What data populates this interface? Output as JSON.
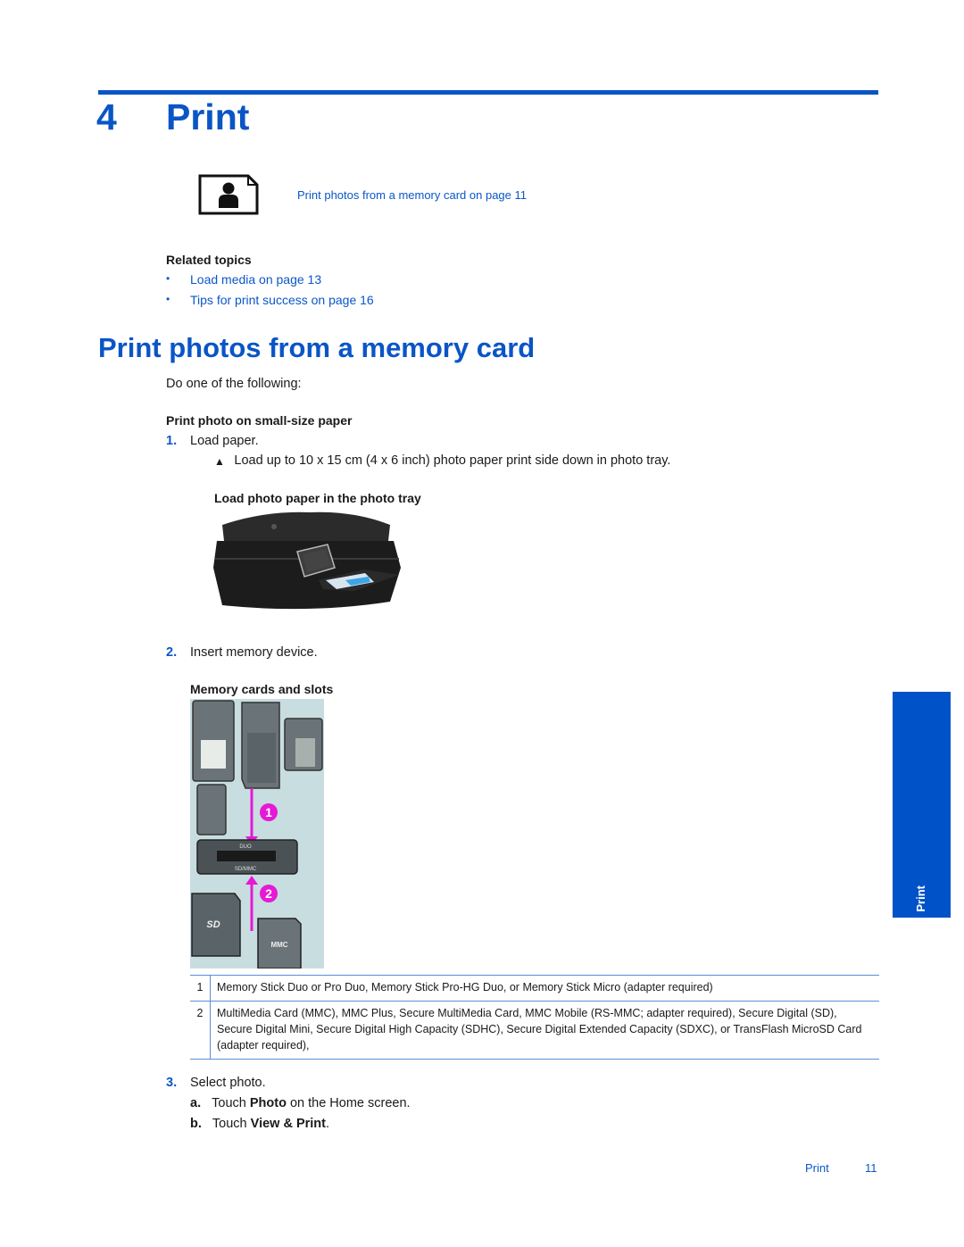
{
  "chapter": {
    "number": "4",
    "title": "Print"
  },
  "toc_link": "Print photos from a memory card on page 11",
  "related": {
    "heading": "Related topics",
    "links": [
      "Load media on page 13",
      "Tips for print success on page 16"
    ]
  },
  "section": {
    "title": "Print photos from a memory card",
    "intro": "Do one of the following:",
    "subheading": "Print photo on small-size paper",
    "steps": [
      {
        "num": "1.",
        "text": "Load paper."
      },
      {
        "num": "2.",
        "text": "Insert memory device."
      },
      {
        "num": "3.",
        "text": "Select photo."
      }
    ],
    "step1_note_icon": "triangle-up-icon",
    "step1_note": "Load up to 10 x 15 cm (4 x 6 inch) photo paper print side down in photo tray.",
    "figure1_caption": "Load photo paper in the photo tray",
    "figure2_caption": "Memory cards and slots",
    "figure2_labels": {
      "slot_top": "DUO",
      "slot_bottom": "SD/MMC",
      "sd_card": "SD",
      "mmc_card": "MMC",
      "callout1": "1",
      "callout2": "2"
    },
    "table": [
      {
        "num": "1",
        "text": "Memory Stick Duo or Pro Duo, Memory Stick Pro-HG Duo, or Memory Stick Micro (adapter required)"
      },
      {
        "num": "2",
        "text": "MultiMedia Card (MMC), MMC Plus, Secure MultiMedia Card, MMC Mobile (RS-MMC; adapter required), Secure Digital (SD), Secure Digital Mini, Secure Digital High Capacity (SDHC), Secure Digital Extended Capacity (SDXC), or TransFlash MicroSD Card (adapter required),"
      }
    ],
    "substeps": [
      {
        "letter": "a.",
        "pre": "Touch ",
        "bold": "Photo",
        "post": " on the Home screen."
      },
      {
        "letter": "b.",
        "pre": "Touch ",
        "bold": "View & Print",
        "post": "."
      }
    ]
  },
  "side_tab": "Print",
  "footer": {
    "section": "Print",
    "page": "11"
  },
  "colors": {
    "accent": "#0a55c6",
    "tab": "#0052c8",
    "table_rule": "#5a8fd4",
    "callout": "#e619d6"
  }
}
